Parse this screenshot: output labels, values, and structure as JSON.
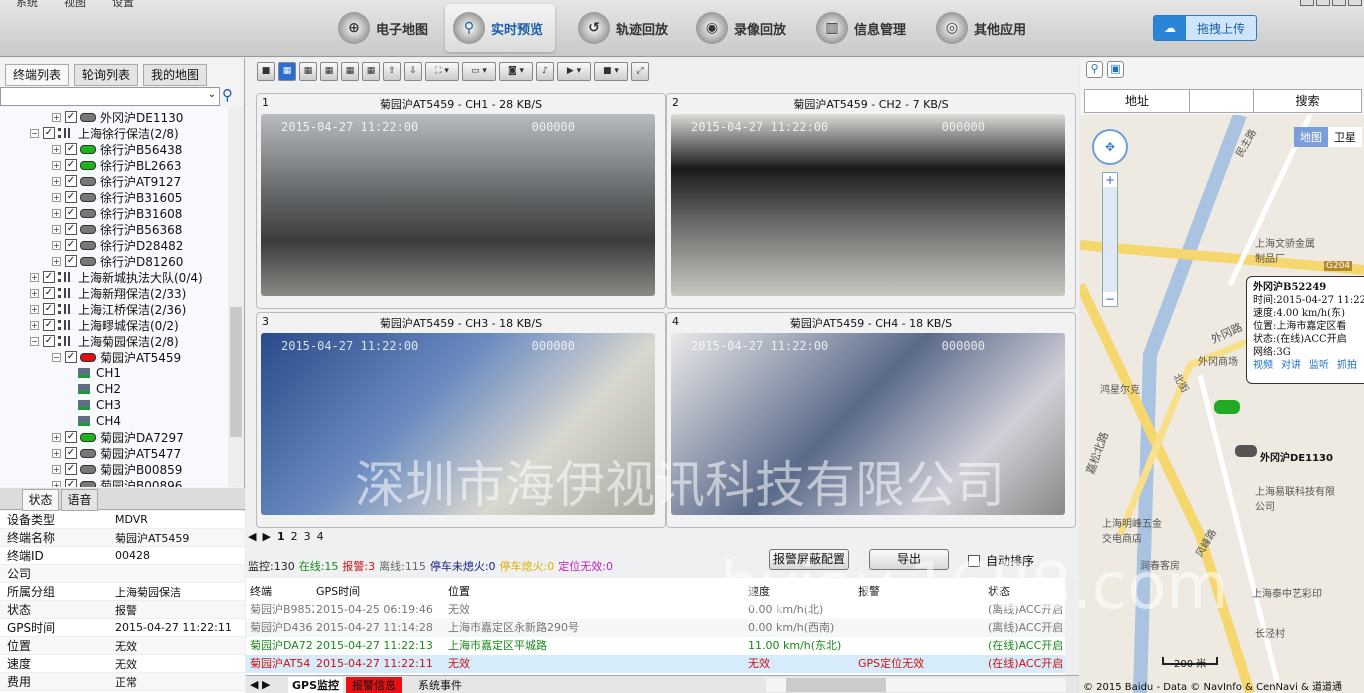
{
  "menu": [
    "系统",
    "视图",
    "设置"
  ],
  "nav": [
    {
      "label": "电子地图",
      "icon": "globe-icon"
    },
    {
      "label": "实时预览",
      "icon": "search-icon",
      "active": true
    },
    {
      "label": "轨迹回放",
      "icon": "track-icon"
    },
    {
      "label": "录像回放",
      "icon": "replay-icon"
    },
    {
      "label": "信息管理",
      "icon": "info-icon"
    },
    {
      "label": "其他应用",
      "icon": "apps-icon"
    }
  ],
  "upload": "拖拽上传",
  "left_tabs": [
    "终端列表",
    "轮询列表",
    "我的地图"
  ],
  "tree": [
    {
      "label": "外冈沪DE1130",
      "type": "car",
      "color": "gray",
      "level": 2
    },
    {
      "label": "上海徐行保洁(2/8)",
      "type": "group",
      "level": 1,
      "open": true
    },
    {
      "label": "徐行沪B56438",
      "type": "car",
      "color": "green",
      "level": 2
    },
    {
      "label": "徐行沪BL2663",
      "type": "car",
      "color": "green",
      "level": 2
    },
    {
      "label": "徐行沪AT9127",
      "type": "car",
      "color": "gray",
      "level": 2
    },
    {
      "label": "徐行沪B31605",
      "type": "car",
      "color": "gray",
      "level": 2
    },
    {
      "label": "徐行沪B31608",
      "type": "car",
      "color": "gray",
      "level": 2
    },
    {
      "label": "徐行沪B56368",
      "type": "car",
      "color": "gray",
      "level": 2
    },
    {
      "label": "徐行沪D28482",
      "type": "car",
      "color": "gray",
      "level": 2
    },
    {
      "label": "徐行沪D81260",
      "type": "car",
      "color": "gray",
      "level": 2
    },
    {
      "label": "上海新城执法大队(0/4)",
      "type": "group",
      "level": 1
    },
    {
      "label": "上海新翔保洁(2/33)",
      "type": "group",
      "level": 1
    },
    {
      "label": "上海江桥保洁(2/36)",
      "type": "group",
      "level": 1
    },
    {
      "label": "上海疁城保洁(0/2)",
      "type": "group",
      "level": 1
    },
    {
      "label": "上海菊园保洁(2/8)",
      "type": "group",
      "level": 1,
      "open": true
    },
    {
      "label": "菊园沪AT5459",
      "type": "car",
      "color": "red",
      "level": 2,
      "open": true
    },
    {
      "label": "CH1",
      "type": "cam",
      "level": 3
    },
    {
      "label": "CH2",
      "type": "cam",
      "level": 3
    },
    {
      "label": "CH3",
      "type": "cam",
      "level": 3
    },
    {
      "label": "CH4",
      "type": "cam",
      "level": 3
    },
    {
      "label": "菊园沪DA7297",
      "type": "car",
      "color": "green",
      "level": 2
    },
    {
      "label": "菊园沪AT5477",
      "type": "car",
      "color": "gray",
      "level": 2
    },
    {
      "label": "菊园沪B00859",
      "type": "car",
      "color": "gray",
      "level": 2
    },
    {
      "label": "菊园沪B00896",
      "type": "car",
      "color": "gray",
      "level": 2
    }
  ],
  "status_tabs": [
    "状态",
    "语音"
  ],
  "props": [
    [
      "设备类型",
      "MDVR"
    ],
    [
      "终端名称",
      "菊园沪AT5459"
    ],
    [
      "终端ID",
      "00428"
    ],
    [
      "公司",
      ""
    ],
    [
      "所属分组",
      "上海菊园保洁"
    ],
    [
      "状态",
      "报警"
    ],
    [
      "GPS时间",
      "2015-04-27 11:22:11"
    ],
    [
      "位置",
      "无效"
    ],
    [
      "速度",
      "无效"
    ],
    [
      "费用",
      "正常"
    ]
  ],
  "videos": [
    {
      "num": "1",
      "title": "菊园沪AT5459 - CH1 - 28 KB/S",
      "ts": "2015-04-27 11:22:00",
      "code": "000000"
    },
    {
      "num": "2",
      "title": "菊园沪AT5459 - CH2 - 7 KB/S",
      "ts": "2015-04-27 11:22:00",
      "code": "000000"
    },
    {
      "num": "3",
      "title": "菊园沪AT5459 - CH3 - 18 KB/S",
      "ts": "2015-04-27 11:22:00",
      "code": "000000"
    },
    {
      "num": "4",
      "title": "菊园沪AT5459 - CH4 - 18 KB/S",
      "ts": "2015-04-27 11:22:00",
      "code": "000000"
    }
  ],
  "pages": [
    "1",
    "2",
    "3",
    "4"
  ],
  "stats": [
    {
      "text": "监控:130",
      "color": "#222"
    },
    {
      "text": "在线:15",
      "color": "#1a8a1a"
    },
    {
      "text": "报警:3",
      "color": "#d01010"
    },
    {
      "text": "离线:115",
      "color": "#666"
    },
    {
      "text": "停车未熄火:0",
      "color": "#1a1a80"
    },
    {
      "text": "停车熄火:0",
      "color": "#e0b000"
    },
    {
      "text": "定位无效:0",
      "color": "#c020c0"
    }
  ],
  "buttons": {
    "alarm_mask": "报警屏蔽配置",
    "export": "导出",
    "auto_sort": "自动排序"
  },
  "table": {
    "headers": [
      "终端",
      "GPS时间",
      "位置",
      "速度",
      "报警",
      "状态"
    ],
    "rows": [
      {
        "cells": [
          "菊园沪B9852",
          "2015-04-25 06:19:46",
          "无效",
          "0.00 km/h(北)",
          "",
          "(离线)ACC开启"
        ],
        "color": "#777"
      },
      {
        "cells": [
          "菊园沪D436",
          "2015-04-27 11:14:28",
          "上海市嘉定区永新路290号",
          "0.00 km/h(西南)",
          "",
          "(离线)ACC开启"
        ],
        "color": "#777"
      },
      {
        "cells": [
          "菊园沪DA72",
          "2015-04-27 11:22:13",
          "上海市嘉定区平城路",
          "11.00 km/h(东北)",
          "",
          "(在线)ACC开启"
        ],
        "color": "#1a8a1a"
      },
      {
        "cells": [
          "菊园沪AT54",
          "2015-04-27 11:22:11",
          "无效",
          "无效",
          "GPS定位无效",
          "(在线)ACC开启"
        ],
        "color": "#d01010",
        "selected": true
      }
    ]
  },
  "bottom_tabs": [
    "GPS监控",
    "报警信息",
    "系统事件"
  ],
  "map": {
    "search_label": "地址",
    "search_button": "搜索",
    "type_map": "地图",
    "type_sat": "卫星",
    "labels": [
      "民主路",
      "上海文骄金属制品厂",
      "G204",
      "外冈路",
      "外冈商场",
      "鸿星尔克",
      "嘉松北路",
      "北街",
      "上海明峰五金交电商店",
      "风峰路",
      "润春客房",
      "上海易联科技有限公司",
      "长泾村",
      "上海泰中艺彩印",
      "外冈沪DE1130"
    ],
    "popup": {
      "title": "外冈沪B52249",
      "lines": [
        "时间:2015-04-27 11:22",
        "速度:4.00 km/h(东)",
        "位置:上海市嘉定区看",
        "状态:(在线)ACC开启",
        "网络:3G"
      ],
      "links": [
        "视频",
        "对讲",
        "监听",
        "抓拍"
      ]
    },
    "scale": "200 米",
    "copyright": "© 2015 Baidu - Data © NavInfo & CenNavi & 道道通"
  },
  "watermark": [
    "深圳市海伊视讯科技有限公司",
    "hyiav.1688.com"
  ]
}
